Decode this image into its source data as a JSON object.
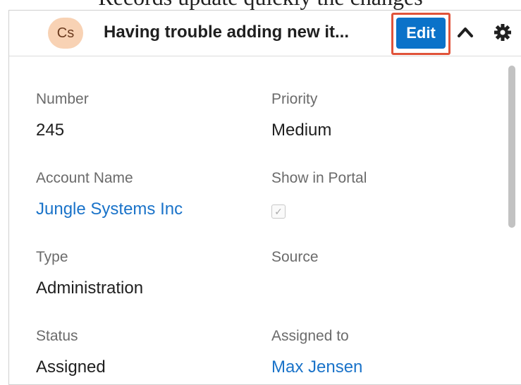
{
  "page_caption": "Records update quickly the changes",
  "header": {
    "avatar_initials": "Cs",
    "record_name": "Having trouble adding new it...",
    "edit_label": "Edit"
  },
  "fields": {
    "number": {
      "label": "Number",
      "value": "245"
    },
    "priority": {
      "label": "Priority",
      "value": "Medium"
    },
    "account_name": {
      "label": "Account Name",
      "value": "Jungle Systems Inc"
    },
    "show_in_portal": {
      "label": "Show in Portal",
      "checked": true
    },
    "type": {
      "label": "Type",
      "value": "Administration"
    },
    "source": {
      "label": "Source",
      "value": ""
    },
    "status": {
      "label": "Status",
      "value": "Assigned"
    },
    "assigned_to": {
      "label": "Assigned to",
      "value": "Max Jensen"
    }
  },
  "colors": {
    "accent": "#0b72c9",
    "highlight": "#e0533a",
    "link": "#1a73c9",
    "avatar_bg": "#f8d2b4"
  },
  "icons": {
    "collapse": "chevron-up-icon",
    "settings": "gear-icon",
    "checkbox_mark": "check-icon"
  }
}
